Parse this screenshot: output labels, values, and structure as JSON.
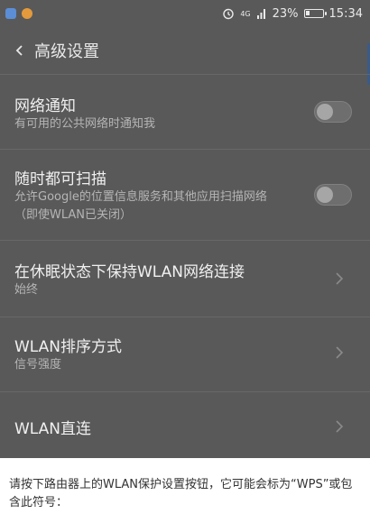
{
  "status_bar": {
    "battery_percent": "23%",
    "battery_level": 0.23,
    "time": "15:34",
    "network": "4G",
    "icons": [
      "app-icon-blue",
      "app-icon-orange",
      "alarm-icon",
      "signal-icon",
      "battery-icon"
    ]
  },
  "header": {
    "title": "高级设置"
  },
  "items": [
    {
      "title": "网络通知",
      "subtitle": "有可用的公共网络时通知我",
      "control": "toggle",
      "checked": false
    },
    {
      "title": "随时都可扫描",
      "subtitle": "允许Google的位置信息服务和其他应用扫描网络（即使WLAN已关闭）",
      "control": "toggle",
      "checked": false
    },
    {
      "title": "在休眠状态下保持WLAN网络连接",
      "subtitle": "始终",
      "control": "chevron"
    },
    {
      "title": "WLAN排序方式",
      "subtitle": "信号强度",
      "control": "chevron"
    },
    {
      "title": "WLAN直连",
      "subtitle": "",
      "control": "chevron"
    }
  ],
  "dialog": {
    "text": "请按下路由器上的WLAN保护设置按钮，它可能会标为“WPS”或包含此符号："
  },
  "colors": {
    "overlay": "#595959",
    "dialog_bg": "#ffffff",
    "icon_blue": "#5b8ed6",
    "icon_orange": "#e39a3c"
  }
}
